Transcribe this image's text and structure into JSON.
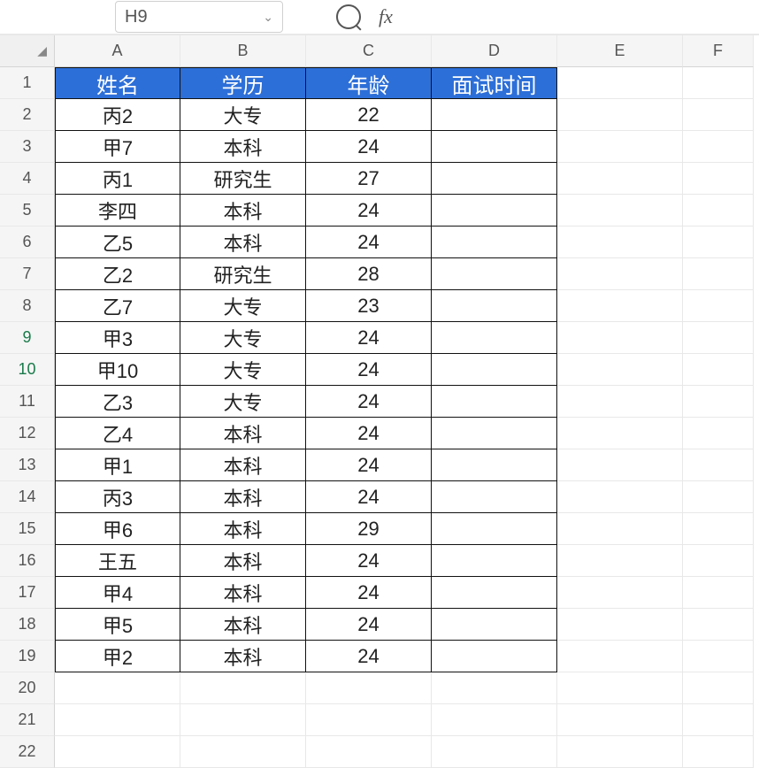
{
  "nameBox": "H9",
  "fxLabel": "fx",
  "cornerLabel": "◢",
  "columns": [
    "A",
    "B",
    "C",
    "D",
    "E",
    "F"
  ],
  "rowNumbers": [
    "1",
    "2",
    "3",
    "4",
    "5",
    "6",
    "7",
    "8",
    "9",
    "10",
    "11",
    "12",
    "13",
    "14",
    "15",
    "16",
    "17",
    "18",
    "19",
    "20",
    "21",
    "22"
  ],
  "selectedRows": [
    9,
    10
  ],
  "headers": {
    "a": "姓名",
    "b": "学历",
    "c": "年龄",
    "d": "面试时间"
  },
  "rows": [
    {
      "a": "丙2",
      "b": "大专",
      "c": "22",
      "d": ""
    },
    {
      "a": "甲7",
      "b": "本科",
      "c": "24",
      "d": ""
    },
    {
      "a": "丙1",
      "b": "研究生",
      "c": "27",
      "d": ""
    },
    {
      "a": "李四",
      "b": "本科",
      "c": "24",
      "d": ""
    },
    {
      "a": "乙5",
      "b": "本科",
      "c": "24",
      "d": ""
    },
    {
      "a": "乙2",
      "b": "研究生",
      "c": "28",
      "d": ""
    },
    {
      "a": "乙7",
      "b": "大专",
      "c": "23",
      "d": ""
    },
    {
      "a": "甲3",
      "b": "大专",
      "c": "24",
      "d": ""
    },
    {
      "a": "甲10",
      "b": "大专",
      "c": "24",
      "d": ""
    },
    {
      "a": "乙3",
      "b": "大专",
      "c": "24",
      "d": ""
    },
    {
      "a": "乙4",
      "b": "本科",
      "c": "24",
      "d": ""
    },
    {
      "a": "甲1",
      "b": "本科",
      "c": "24",
      "d": ""
    },
    {
      "a": "丙3",
      "b": "本科",
      "c": "24",
      "d": ""
    },
    {
      "a": "甲6",
      "b": "本科",
      "c": "29",
      "d": ""
    },
    {
      "a": "王五",
      "b": "本科",
      "c": "24",
      "d": ""
    },
    {
      "a": "甲4",
      "b": "本科",
      "c": "24",
      "d": ""
    },
    {
      "a": "甲5",
      "b": "本科",
      "c": "24",
      "d": ""
    },
    {
      "a": "甲2",
      "b": "本科",
      "c": "24",
      "d": ""
    }
  ],
  "emptyRows": 3
}
